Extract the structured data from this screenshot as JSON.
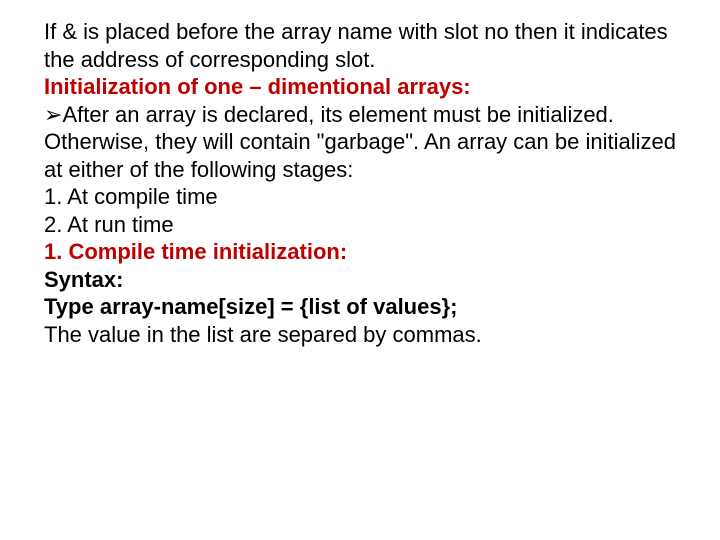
{
  "content": {
    "intro": "If & is placed before the array name with slot no then it indicates the address of corresponding slot.",
    "init_heading": "Initialization of one – dimentional arrays:",
    "bullet_symbol": "➢",
    "after_declared": "After an array is declared, its element must be initialized. Otherwise, they will contain \"garbage\". An array can be initialized at either of the following stages:",
    "stage1": "1. At compile time",
    "stage2": "2. At run time",
    "compile_heading": "1. Compile time initialization:",
    "syntax_label": "Syntax:",
    "syntax_line": "Type array-name[size] = {list of values};",
    "closing": "The value in the list are separed by commas."
  }
}
